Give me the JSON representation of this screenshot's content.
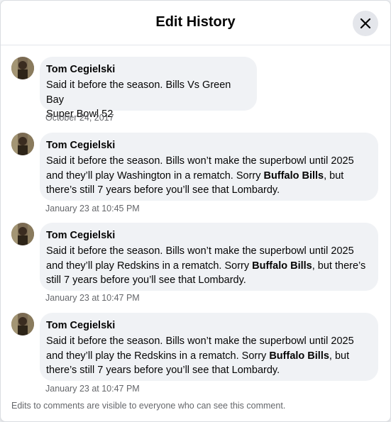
{
  "dialog": {
    "title": "Edit History",
    "close_icon": "close-icon",
    "footer": "Edits to comments are visible to everyone who can see this comment."
  },
  "entries": [
    {
      "author": "Tom Cegielski",
      "text": "Said it before the season. Bills Vs Green Bay\nSuper Bowl 52",
      "timestamp": "October 24, 2017"
    },
    {
      "author": "Tom Cegielski",
      "text_before": "Said it before the season. Bills won’t make the superbowl until 2025\nand they’ll play Washington in a rematch. Sorry ",
      "mention": "Buffalo Bills",
      "text_after": ", but\nthere’s still 7 years before you’ll see that Lombardy.",
      "timestamp": "January 23 at 10:45 PM"
    },
    {
      "author": "Tom Cegielski",
      "text_before": "Said it before the season. Bills won’t make the superbowl until 2025\nand they’ll play Redskins in a rematch. Sorry ",
      "mention": "Buffalo Bills",
      "text_after": ", but there’s\nstill 7 years before you’ll see that Lombardy.",
      "timestamp": "January 23 at 10:47 PM"
    },
    {
      "author": "Tom Cegielski",
      "text_before": "Said it before the season. Bills won’t make the superbowl until 2025\nand they’ll play the Redskins in a rematch. Sorry ",
      "mention": "Buffalo Bills",
      "text_after": ", but\nthere’s still 7 years before you’ll see that Lombardy.",
      "timestamp": "January 23 at 10:47 PM"
    }
  ]
}
